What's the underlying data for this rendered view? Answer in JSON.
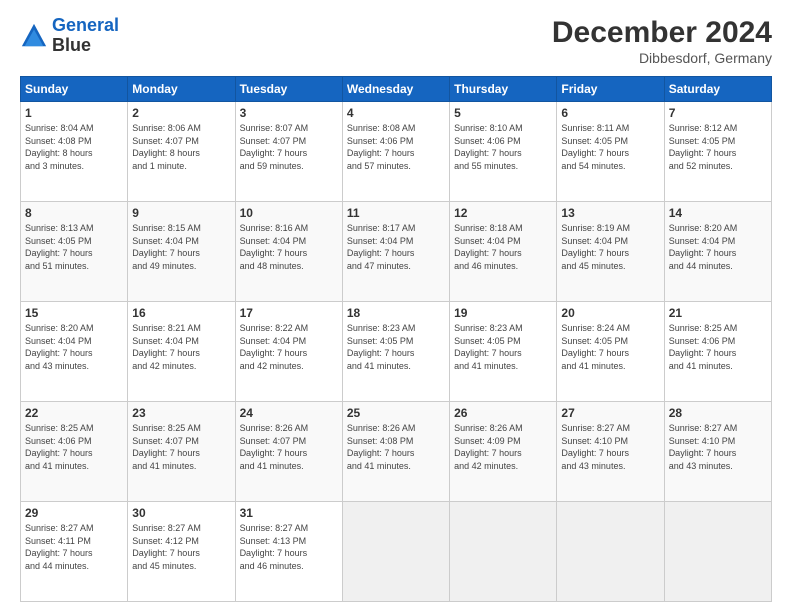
{
  "header": {
    "logo_line1": "General",
    "logo_line2": "Blue",
    "title": "December 2024",
    "subtitle": "Dibbesdorf, Germany"
  },
  "days_of_week": [
    "Sunday",
    "Monday",
    "Tuesday",
    "Wednesday",
    "Thursday",
    "Friday",
    "Saturday"
  ],
  "weeks": [
    [
      {
        "day": "1",
        "info": "Sunrise: 8:04 AM\nSunset: 4:08 PM\nDaylight: 8 hours\nand 3 minutes."
      },
      {
        "day": "2",
        "info": "Sunrise: 8:06 AM\nSunset: 4:07 PM\nDaylight: 8 hours\nand 1 minute."
      },
      {
        "day": "3",
        "info": "Sunrise: 8:07 AM\nSunset: 4:07 PM\nDaylight: 7 hours\nand 59 minutes."
      },
      {
        "day": "4",
        "info": "Sunrise: 8:08 AM\nSunset: 4:06 PM\nDaylight: 7 hours\nand 57 minutes."
      },
      {
        "day": "5",
        "info": "Sunrise: 8:10 AM\nSunset: 4:06 PM\nDaylight: 7 hours\nand 55 minutes."
      },
      {
        "day": "6",
        "info": "Sunrise: 8:11 AM\nSunset: 4:05 PM\nDaylight: 7 hours\nand 54 minutes."
      },
      {
        "day": "7",
        "info": "Sunrise: 8:12 AM\nSunset: 4:05 PM\nDaylight: 7 hours\nand 52 minutes."
      }
    ],
    [
      {
        "day": "8",
        "info": "Sunrise: 8:13 AM\nSunset: 4:05 PM\nDaylight: 7 hours\nand 51 minutes."
      },
      {
        "day": "9",
        "info": "Sunrise: 8:15 AM\nSunset: 4:04 PM\nDaylight: 7 hours\nand 49 minutes."
      },
      {
        "day": "10",
        "info": "Sunrise: 8:16 AM\nSunset: 4:04 PM\nDaylight: 7 hours\nand 48 minutes."
      },
      {
        "day": "11",
        "info": "Sunrise: 8:17 AM\nSunset: 4:04 PM\nDaylight: 7 hours\nand 47 minutes."
      },
      {
        "day": "12",
        "info": "Sunrise: 8:18 AM\nSunset: 4:04 PM\nDaylight: 7 hours\nand 46 minutes."
      },
      {
        "day": "13",
        "info": "Sunrise: 8:19 AM\nSunset: 4:04 PM\nDaylight: 7 hours\nand 45 minutes."
      },
      {
        "day": "14",
        "info": "Sunrise: 8:20 AM\nSunset: 4:04 PM\nDaylight: 7 hours\nand 44 minutes."
      }
    ],
    [
      {
        "day": "15",
        "info": "Sunrise: 8:20 AM\nSunset: 4:04 PM\nDaylight: 7 hours\nand 43 minutes."
      },
      {
        "day": "16",
        "info": "Sunrise: 8:21 AM\nSunset: 4:04 PM\nDaylight: 7 hours\nand 42 minutes."
      },
      {
        "day": "17",
        "info": "Sunrise: 8:22 AM\nSunset: 4:04 PM\nDaylight: 7 hours\nand 42 minutes."
      },
      {
        "day": "18",
        "info": "Sunrise: 8:23 AM\nSunset: 4:05 PM\nDaylight: 7 hours\nand 41 minutes."
      },
      {
        "day": "19",
        "info": "Sunrise: 8:23 AM\nSunset: 4:05 PM\nDaylight: 7 hours\nand 41 minutes."
      },
      {
        "day": "20",
        "info": "Sunrise: 8:24 AM\nSunset: 4:05 PM\nDaylight: 7 hours\nand 41 minutes."
      },
      {
        "day": "21",
        "info": "Sunrise: 8:25 AM\nSunset: 4:06 PM\nDaylight: 7 hours\nand 41 minutes."
      }
    ],
    [
      {
        "day": "22",
        "info": "Sunrise: 8:25 AM\nSunset: 4:06 PM\nDaylight: 7 hours\nand 41 minutes."
      },
      {
        "day": "23",
        "info": "Sunrise: 8:25 AM\nSunset: 4:07 PM\nDaylight: 7 hours\nand 41 minutes."
      },
      {
        "day": "24",
        "info": "Sunrise: 8:26 AM\nSunset: 4:07 PM\nDaylight: 7 hours\nand 41 minutes."
      },
      {
        "day": "25",
        "info": "Sunrise: 8:26 AM\nSunset: 4:08 PM\nDaylight: 7 hours\nand 41 minutes."
      },
      {
        "day": "26",
        "info": "Sunrise: 8:26 AM\nSunset: 4:09 PM\nDaylight: 7 hours\nand 42 minutes."
      },
      {
        "day": "27",
        "info": "Sunrise: 8:27 AM\nSunset: 4:10 PM\nDaylight: 7 hours\nand 43 minutes."
      },
      {
        "day": "28",
        "info": "Sunrise: 8:27 AM\nSunset: 4:10 PM\nDaylight: 7 hours\nand 43 minutes."
      }
    ],
    [
      {
        "day": "29",
        "info": "Sunrise: 8:27 AM\nSunset: 4:11 PM\nDaylight: 7 hours\nand 44 minutes."
      },
      {
        "day": "30",
        "info": "Sunrise: 8:27 AM\nSunset: 4:12 PM\nDaylight: 7 hours\nand 45 minutes."
      },
      {
        "day": "31",
        "info": "Sunrise: 8:27 AM\nSunset: 4:13 PM\nDaylight: 7 hours\nand 46 minutes."
      },
      null,
      null,
      null,
      null
    ]
  ]
}
